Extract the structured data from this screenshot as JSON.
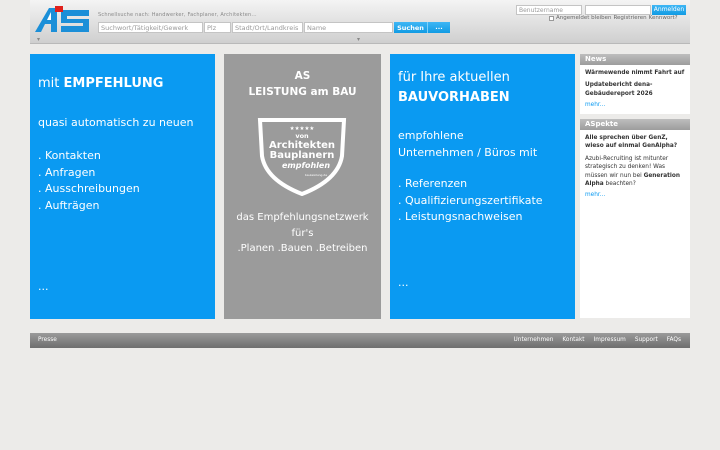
{
  "header": {
    "logo_text": "AS",
    "tagline": "Schnellsuche nach: Handwerker, Fachplaner, Architekten...",
    "search": {
      "keyword_placeholder": "Suchwort/Tätigkeit/Gewerk",
      "zip_placeholder": "Plz",
      "city_placeholder": "Stadt/Ort/Landkreis",
      "name_placeholder": "Name",
      "button_label": "Suchen",
      "more_label": "..."
    },
    "login": {
      "username_placeholder": "Benutzername",
      "password_placeholder": "",
      "button_label": "Anmelden",
      "remember_label": "Angemeldet bleiben",
      "register_label": "Registrieren",
      "forgot_label": "Kennwort?"
    }
  },
  "panel_left": {
    "heading_prefix": "mit ",
    "heading_bold": "EMPFEHLUNG",
    "subtext": "quasi automatisch zu neuen",
    "items": [
      ". Kontakten",
      ". Anfragen",
      ". Ausschreibungen",
      ". Aufträgen"
    ],
    "ellipsis": "..."
  },
  "panel_center": {
    "title_line1": "AS",
    "title_line2": "LEISTUNG am BAU",
    "badge": {
      "stars": "★★★★★",
      "line1": "von",
      "line2": "Architekten",
      "line3": "Bauplanern",
      "line4": "empfohlen",
      "small_text": "bauleistung.de"
    },
    "desc_line1": "das Empfehlungsnetzwerk",
    "desc_line2": "für's",
    "desc_line3": ".Planen .Bauen .Betreiben"
  },
  "panel_right": {
    "heading_line1": "für Ihre aktuellen",
    "heading_line2": "BAUVORHABEN",
    "sub_line1": "empfohlene",
    "sub_line2": "Unternehmen / Büros mit",
    "items": [
      ". Referenzen",
      ". Qualifizierungszertifikate",
      ". Leistungsnachweisen"
    ],
    "ellipsis": "..."
  },
  "sidebar": {
    "news": {
      "title": "News",
      "headline1": "Wärmewende nimmt Fahrt auf",
      "headline2": "Updatebericht dena-Gebäudereport 2026",
      "more": "mehr..."
    },
    "aspekte": {
      "title": "ASpekte",
      "headline": "Alle sprechen über GenZ, wieso auf einmal GenAlpha?",
      "body": "Azubi-Recruiting ist mitunter strategisch zu denken! Was müssen wir nun bei",
      "body_bold": "Generation Alpha",
      "body_end": "beachten?",
      "more": "mehr..."
    }
  },
  "footer": {
    "press": "Presse",
    "links": [
      "Unternehmen",
      "Kontakt",
      "Impressum",
      "Support",
      "FAQs"
    ]
  },
  "colors": {
    "accent_blue": "#0a9af2",
    "panel_gray": "#9b9b9b"
  }
}
